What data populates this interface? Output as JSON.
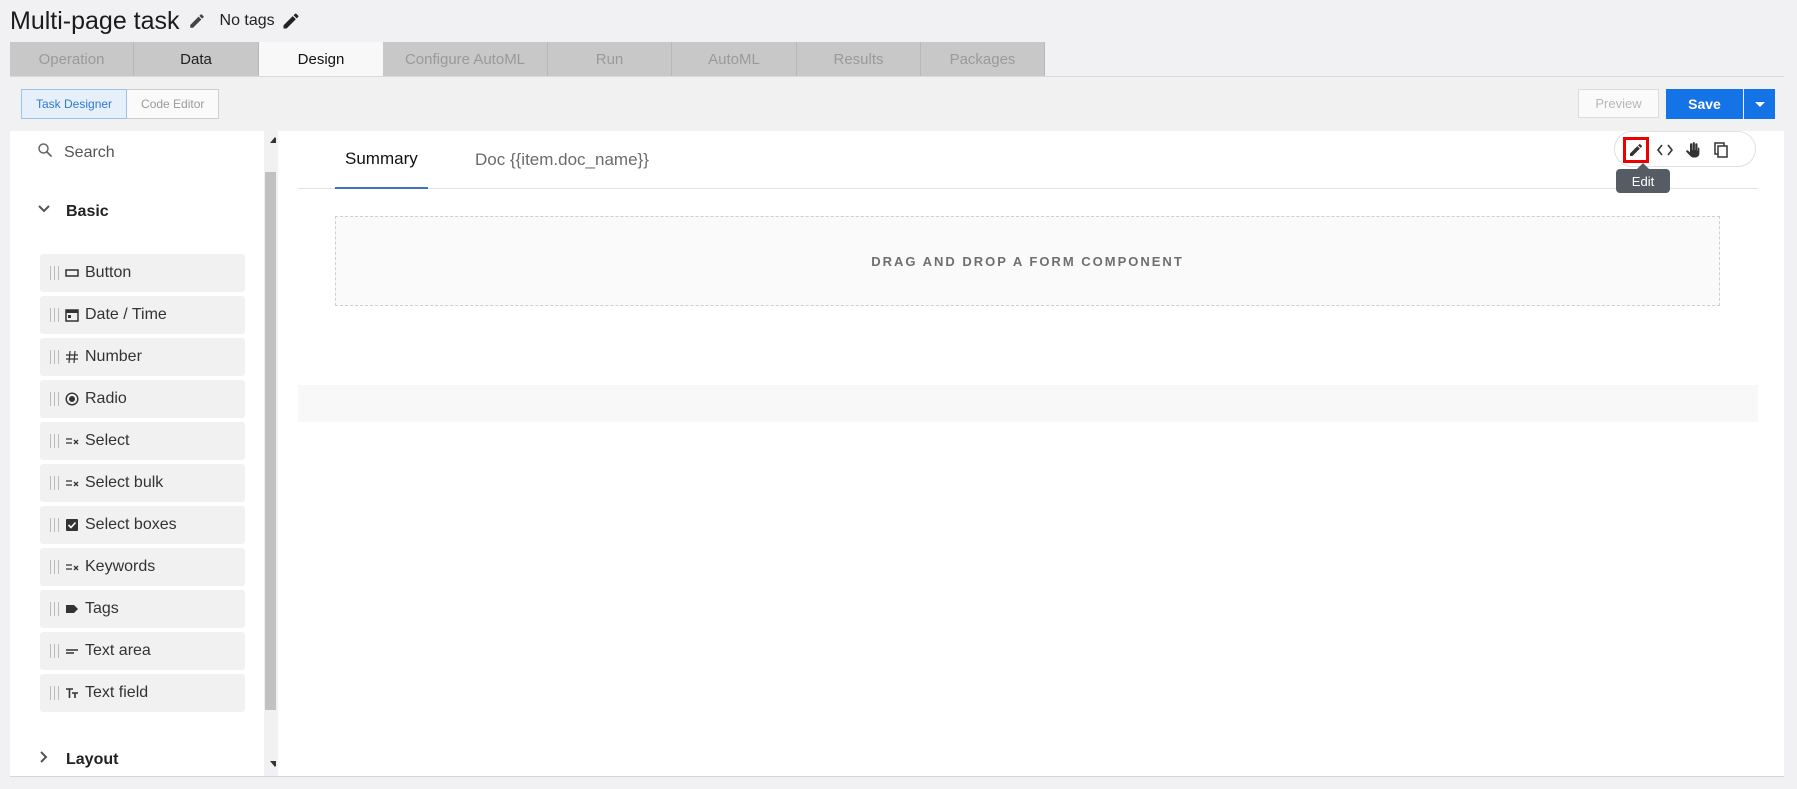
{
  "header": {
    "title": "Multi-page task",
    "tags_label": "No tags"
  },
  "main_tabs": [
    {
      "label": "Operation",
      "state": "disabled"
    },
    {
      "label": "Data",
      "state": "normal"
    },
    {
      "label": "Design",
      "state": "active"
    },
    {
      "label": "Configure AutoML",
      "state": "disabled"
    },
    {
      "label": "Run",
      "state": "disabled"
    },
    {
      "label": "AutoML",
      "state": "disabled"
    },
    {
      "label": "Results",
      "state": "disabled"
    },
    {
      "label": "Packages",
      "state": "disabled"
    }
  ],
  "toolbar": {
    "task_designer_label": "Task Designer",
    "code_editor_label": "Code Editor",
    "preview_label": "Preview",
    "save_label": "Save"
  },
  "palette": {
    "search_placeholder": "Search",
    "groups": [
      {
        "label": "Basic",
        "expanded": true
      },
      {
        "label": "Layout",
        "expanded": false
      }
    ],
    "components": [
      {
        "label": "Button",
        "icon": "button-icon"
      },
      {
        "label": "Date / Time",
        "icon": "calendar-icon"
      },
      {
        "label": "Number",
        "icon": "hash-icon"
      },
      {
        "label": "Radio",
        "icon": "radio-icon"
      },
      {
        "label": "Select",
        "icon": "select-list-icon"
      },
      {
        "label": "Select bulk",
        "icon": "select-list-icon"
      },
      {
        "label": "Select boxes",
        "icon": "checkbox-icon"
      },
      {
        "label": "Keywords",
        "icon": "select-list-icon"
      },
      {
        "label": "Tags",
        "icon": "tag-icon"
      },
      {
        "label": "Text area",
        "icon": "text-area-icon"
      },
      {
        "label": "Text field",
        "icon": "text-field-icon"
      }
    ]
  },
  "canvas": {
    "page_tabs": [
      {
        "label": "Summary",
        "active": true
      },
      {
        "label": "Doc {{item.doc_name}}",
        "active": false
      }
    ],
    "tool_tooltip": "Edit",
    "drop_zone_text": "DRAG AND DROP A FORM COMPONENT"
  },
  "colors": {
    "primary": "#1473e6",
    "highlight": "#e00000",
    "tab_underline": "#3a74c4"
  }
}
